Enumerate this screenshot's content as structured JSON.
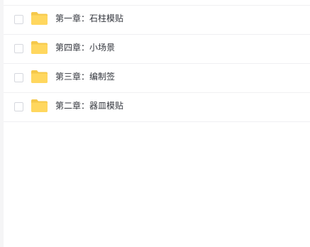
{
  "file_list": {
    "items": [
      {
        "name": "第一章：石柱模贴",
        "icon": "folder-icon",
        "checked": false
      },
      {
        "name": "第四章：小场景",
        "icon": "folder-icon",
        "checked": false
      },
      {
        "name": "第三章：编制签",
        "icon": "folder-icon",
        "checked": false
      },
      {
        "name": "第二章：器皿模贴",
        "icon": "folder-icon",
        "checked": false
      }
    ]
  },
  "colors": {
    "folder_back": "#f5c84a",
    "folder_front": "#ffd75e",
    "text": "#33363d",
    "divider": "#f0f0f2",
    "checkbox_border": "#d6d8de"
  }
}
